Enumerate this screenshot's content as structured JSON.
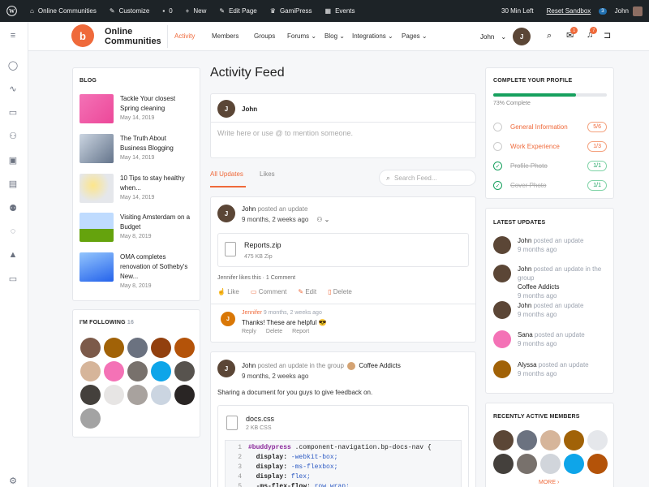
{
  "adminbar": {
    "site_name": "Online Communities",
    "customize": "Customize",
    "comments_count": "0",
    "new": "New",
    "edit_page": "Edit Page",
    "gamipress": "GamiPress",
    "events": "Events",
    "time_left": "30 Min Left",
    "reset_sandbox": "Reset Sandbox",
    "badge": "3",
    "user": "John"
  },
  "header": {
    "logo_line1": "Online",
    "logo_line2": "Communities",
    "nav": [
      "Activity",
      "Members",
      "Groups",
      "Forums",
      "Blog",
      "Integrations",
      "Pages"
    ],
    "user_name": "John",
    "messages_count": "1",
    "notifications_count": "7"
  },
  "blog": {
    "title": "BLOG",
    "items": [
      {
        "title": "Tackle Your closest Spring cleaning",
        "date": "May 14, 2019"
      },
      {
        "title": "The Truth About Business Blogging",
        "date": "May 14, 2019"
      },
      {
        "title": "10 Tips to stay healthy when...",
        "date": "May 14, 2019"
      },
      {
        "title": "Visiting Amsterdam on a Budget",
        "date": "May 8, 2019"
      },
      {
        "title": "OMA completes renovation of Sotheby's New...",
        "date": "May 8, 2019"
      }
    ]
  },
  "following": {
    "title": "I'M FOLLOWING",
    "count": "16"
  },
  "feed": {
    "page_title": "Activity Feed",
    "composer_user": "John",
    "composer_placeholder": "Write here or use @ to mention someone.",
    "tabs": [
      "All Updates",
      "Likes"
    ],
    "search_placeholder": "Search Feed...",
    "post1": {
      "author": "John",
      "action": "posted an update",
      "time": "9 months, 2 weeks ago",
      "file_name": "Reports.zip",
      "file_meta": "475 KB  Zip",
      "likes_text": "Jennifer likes this · 1 Comment",
      "actions": [
        "Like",
        "Comment",
        "Edit",
        "Delete"
      ],
      "comment": {
        "author": "Jennifer",
        "time": "9 months, 2 weeks ago",
        "text": "Thanks! These are helpful 😎",
        "actions": [
          "Reply",
          "Delete",
          "Report"
        ]
      }
    },
    "post2": {
      "author": "John",
      "action": "posted an update in the group",
      "group": "Coffee Addicts",
      "time": "9 months, 2 weeks ago",
      "text": "Sharing a document for you guys to give feedback on.",
      "file_name": "docs.css",
      "file_meta": "2 KB  CSS",
      "code_lines": [
        {
          "n": "1",
          "parts": [
            [
              "sel",
              "#buddypress"
            ],
            [
              "txt",
              " .component-navigation.bp-docs-nav {"
            ]
          ]
        },
        {
          "n": "2",
          "parts": [
            [
              "prop",
              "  display:"
            ],
            [
              "val",
              " -webkit-box;"
            ]
          ]
        },
        {
          "n": "3",
          "parts": [
            [
              "prop",
              "  display:"
            ],
            [
              "val",
              " -ms-flexbox;"
            ]
          ]
        },
        {
          "n": "4",
          "parts": [
            [
              "prop",
              "  display:"
            ],
            [
              "val",
              " flex;"
            ]
          ]
        },
        {
          "n": "5",
          "parts": [
            [
              "prop",
              "  -ms-flex-flow:"
            ],
            [
              "val",
              " row wrap;"
            ]
          ]
        }
      ]
    }
  },
  "profile": {
    "title": "COMPLETE YOUR PROFILE",
    "progress_pct": 73,
    "progress_label": "73% Complete",
    "items": [
      {
        "label": "General Information",
        "value": "5/6",
        "done": false
      },
      {
        "label": "Work Experience",
        "value": "1/3",
        "done": false
      },
      {
        "label": "Profile Photo",
        "value": "1/1",
        "done": true
      },
      {
        "label": "Cover Photo",
        "value": "1/1",
        "done": true
      }
    ]
  },
  "latest": {
    "title": "LATEST UPDATES",
    "items": [
      {
        "name": "John",
        "action": "posted an update",
        "extra": "",
        "time": "9 months ago"
      },
      {
        "name": "John",
        "action": "posted an update in the group",
        "extra": "Coffee Addicts",
        "time": "9 months ago"
      },
      {
        "name": "John",
        "action": "posted an update",
        "extra": "",
        "time": "9 months ago"
      },
      {
        "name": "Sana",
        "action": "posted an update",
        "extra": "",
        "time": "9 months ago"
      },
      {
        "name": "Alyssa",
        "action": "posted an update",
        "extra": "",
        "time": "9 months ago"
      }
    ]
  },
  "recent_members": {
    "title": "RECENTLY ACTIVE MEMBERS",
    "more": "MORE"
  },
  "colors": {
    "accent": "#ef6a3b",
    "success": "#17a05e",
    "adminbar": "#1d2327"
  }
}
